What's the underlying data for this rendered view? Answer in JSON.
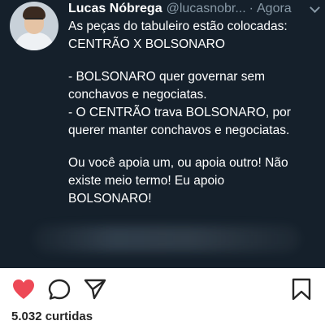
{
  "tweet": {
    "display_name": "Lucas Nóbrega",
    "handle": "@lucasnobr...",
    "separator": "·",
    "time": "Agora",
    "lines": [
      "As peças do tabuleiro estão colocadas:",
      "CENTRÃO X BOLSONARO",
      "",
      "- BOLSONARO quer governar sem",
      "conchavos e negociatas.",
      "- O CENTRÃO trava BOLSONARO, por",
      "querer manter conchavos e negociatas.",
      "",
      "Ou você apoia um, ou apoia outro! Não",
      "existe meio termo! Eu apoio",
      "BOLSONARO!"
    ]
  },
  "post": {
    "likes_label": "5.032 curtidas"
  },
  "icons": {
    "like": "heart-icon",
    "comment": "comment-icon",
    "share": "share-icon",
    "save": "bookmark-icon",
    "menu": "chevron-down-icon"
  },
  "colors": {
    "tweet_background": "#15202b",
    "heart": "#ed4956",
    "muted": "#8899a6"
  }
}
